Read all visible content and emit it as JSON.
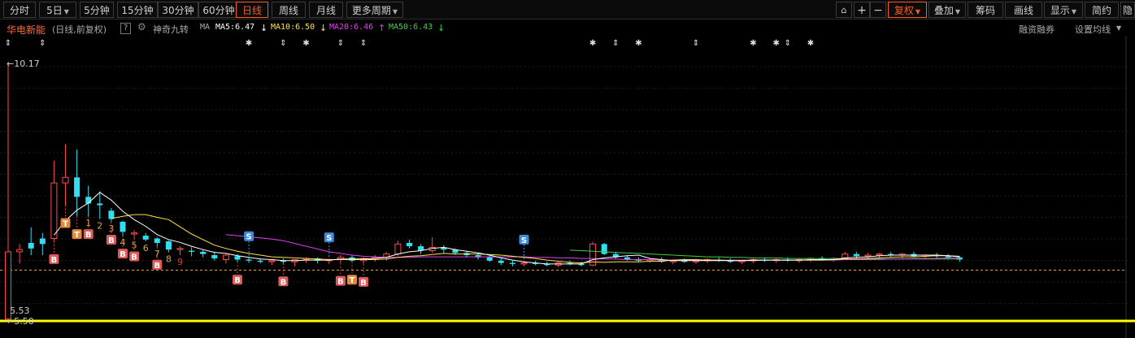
{
  "toolbar": {
    "left": [
      "分时",
      "5日",
      "5分钟",
      "15分钟",
      "30分钟",
      "60分钟",
      "日线",
      "周线",
      "月线",
      "更多周期"
    ],
    "active_period": "日线",
    "right_icons": [
      "lock-icon",
      "plus-icon",
      "minus-icon"
    ],
    "right": [
      "复权",
      "叠加",
      "筹码",
      "画线",
      "显示",
      "简约",
      "隐"
    ],
    "active_right": "复权"
  },
  "info": {
    "stock_name": "华电新能",
    "period_desc": "(日线,前复权)",
    "help": "?",
    "indicator": "神奇九转",
    "ma_label": "MA",
    "ma5": "MA5:6.47",
    "ma10": "MA10:6.50",
    "ma20": "MA20:6.46",
    "ma50": "MA50:6.43",
    "ma5_arrow": "↓",
    "ma10_arrow": "↓",
    "ma20_arrow": "↑",
    "ma50_arrow": "↓",
    "margin_link": "融资融券",
    "ma_settings": "设置均线"
  },
  "colors": {
    "bg": "#000000",
    "up": "#ff4a4a",
    "down": "#30e0f0",
    "ma5": "#ffffff",
    "ma10": "#ffe04a",
    "ma20": "#e040f0",
    "ma50": "#40d040",
    "current_price": "#ffff00",
    "accent": "#ff5a1e"
  },
  "chart_data": {
    "type": "candlestick",
    "price_high_label": "10.17",
    "price_low_label": "5.53",
    "bottom_label": "5.50",
    "ylim": [
      5.5,
      10.3
    ],
    "current_price": 6.43,
    "dates": 84,
    "candles": [
      [
        5.55,
        10.17,
        5.53,
        6.76
      ],
      [
        6.76,
        6.9,
        6.55,
        6.8
      ],
      [
        6.92,
        7.2,
        6.7,
        6.82
      ],
      [
        7.0,
        7.1,
        6.7,
        6.9
      ],
      [
        7.0,
        8.4,
        6.95,
        8.0
      ],
      [
        8.0,
        8.7,
        7.6,
        8.1
      ],
      [
        8.1,
        8.6,
        7.4,
        7.75
      ],
      [
        7.75,
        7.95,
        7.4,
        7.63
      ],
      [
        7.63,
        7.85,
        7.35,
        7.6
      ],
      [
        7.5,
        7.55,
        7.3,
        7.35
      ],
      [
        7.3,
        7.32,
        7.05,
        7.12
      ],
      [
        7.08,
        7.15,
        7.0,
        7.1
      ],
      [
        7.05,
        7.1,
        6.95,
        6.98
      ],
      [
        7.0,
        7.02,
        6.85,
        6.92
      ],
      [
        6.95,
        6.96,
        6.75,
        6.8
      ],
      [
        6.8,
        6.86,
        6.7,
        6.82
      ],
      [
        6.78,
        6.84,
        6.68,
        6.76
      ],
      [
        6.76,
        6.8,
        6.66,
        6.72
      ],
      [
        6.7,
        6.76,
        6.6,
        6.64
      ],
      [
        6.62,
        6.72,
        6.55,
        6.7
      ],
      [
        6.68,
        6.72,
        6.58,
        6.62
      ],
      [
        6.62,
        6.66,
        6.56,
        6.6
      ],
      [
        6.6,
        6.64,
        6.55,
        6.58
      ],
      [
        6.58,
        6.62,
        6.52,
        6.6
      ],
      [
        6.6,
        6.64,
        6.55,
        6.58
      ],
      [
        6.58,
        6.62,
        6.5,
        6.62
      ],
      [
        6.62,
        6.66,
        6.56,
        6.64
      ],
      [
        6.64,
        6.66,
        6.55,
        6.6
      ],
      [
        6.6,
        6.64,
        6.54,
        6.62
      ],
      [
        6.62,
        6.7,
        6.56,
        6.66
      ],
      [
        6.66,
        6.7,
        6.58,
        6.6
      ],
      [
        6.6,
        6.66,
        6.54,
        6.64
      ],
      [
        6.64,
        6.7,
        6.58,
        6.66
      ],
      [
        6.66,
        6.76,
        6.6,
        6.72
      ],
      [
        6.72,
        6.96,
        6.68,
        6.9
      ],
      [
        6.92,
        6.98,
        6.82,
        6.86
      ],
      [
        6.86,
        6.9,
        6.72,
        6.78
      ],
      [
        6.78,
        7.02,
        6.74,
        6.84
      ],
      [
        6.84,
        6.88,
        6.74,
        6.8
      ],
      [
        6.8,
        6.82,
        6.7,
        6.74
      ],
      [
        6.74,
        6.78,
        6.66,
        6.7
      ],
      [
        6.7,
        6.74,
        6.62,
        6.66
      ],
      [
        6.66,
        6.7,
        6.58,
        6.6
      ],
      [
        6.6,
        6.64,
        6.52,
        6.56
      ],
      [
        6.56,
        6.6,
        6.5,
        6.54
      ],
      [
        6.54,
        6.6,
        6.5,
        6.56
      ],
      [
        6.56,
        6.6,
        6.52,
        6.54
      ],
      [
        6.54,
        6.58,
        6.5,
        6.52
      ],
      [
        6.52,
        6.58,
        6.48,
        6.56
      ],
      [
        6.56,
        6.6,
        6.52,
        6.54
      ],
      [
        6.54,
        6.58,
        6.5,
        6.52
      ],
      [
        6.52,
        6.94,
        6.5,
        6.9
      ],
      [
        6.9,
        6.92,
        6.7,
        6.72
      ],
      [
        6.72,
        6.76,
        6.62,
        6.66
      ],
      [
        6.66,
        6.7,
        6.6,
        6.62
      ],
      [
        6.62,
        6.66,
        6.58,
        6.6
      ],
      [
        6.6,
        6.64,
        6.56,
        6.62
      ],
      [
        6.62,
        6.66,
        6.56,
        6.58
      ],
      [
        6.58,
        6.62,
        6.54,
        6.6
      ],
      [
        6.6,
        6.64,
        6.56,
        6.58
      ],
      [
        6.58,
        6.62,
        6.54,
        6.6
      ],
      [
        6.6,
        6.64,
        6.56,
        6.62
      ],
      [
        6.62,
        6.66,
        6.58,
        6.6
      ],
      [
        6.6,
        6.64,
        6.56,
        6.58
      ],
      [
        6.58,
        6.62,
        6.54,
        6.6
      ],
      [
        6.6,
        6.64,
        6.56,
        6.62
      ],
      [
        6.62,
        6.66,
        6.58,
        6.6
      ],
      [
        6.6,
        6.64,
        6.56,
        6.62
      ],
      [
        6.62,
        6.66,
        6.58,
        6.6
      ],
      [
        6.6,
        6.64,
        6.56,
        6.62
      ],
      [
        6.62,
        6.66,
        6.58,
        6.64
      ],
      [
        6.64,
        6.68,
        6.6,
        6.62
      ],
      [
        6.62,
        6.66,
        6.58,
        6.64
      ],
      [
        6.64,
        6.76,
        6.62,
        6.72
      ],
      [
        6.72,
        6.76,
        6.64,
        6.68
      ],
      [
        6.68,
        6.74,
        6.64,
        6.7
      ],
      [
        6.7,
        6.74,
        6.64,
        6.72
      ],
      [
        6.72,
        6.76,
        6.66,
        6.7
      ],
      [
        6.7,
        6.74,
        6.64,
        6.72
      ],
      [
        6.72,
        6.76,
        6.66,
        6.68
      ],
      [
        6.68,
        6.72,
        6.62,
        6.7
      ],
      [
        6.7,
        6.74,
        6.64,
        6.68
      ],
      [
        6.68,
        6.72,
        6.62,
        6.66
      ],
      [
        6.66,
        6.68,
        6.58,
        6.62
      ]
    ],
    "ma5": [
      null,
      null,
      null,
      null,
      7.06,
      7.32,
      7.51,
      7.64,
      7.83,
      7.69,
      7.49,
      7.34,
      7.22,
      7.07,
      6.98,
      6.93,
      6.86,
      6.8,
      6.75,
      6.73,
      6.69,
      6.66,
      6.63,
      6.62,
      6.6,
      6.6,
      6.61,
      6.61,
      6.61,
      6.63,
      6.63,
      6.63,
      6.64,
      6.66,
      6.72,
      6.76,
      6.78,
      6.82,
      6.84,
      6.8,
      6.77,
      6.74,
      6.7,
      6.65,
      6.61,
      6.58,
      6.56,
      6.54,
      6.54,
      6.54,
      6.54,
      6.62,
      6.65,
      6.67,
      6.69,
      6.7,
      6.64,
      6.62,
      6.6,
      6.6,
      6.6,
      6.6,
      6.6,
      6.6,
      6.6,
      6.61,
      6.61,
      6.61,
      6.61,
      6.61,
      6.62,
      6.62,
      6.62,
      6.65,
      6.66,
      6.67,
      6.69,
      6.7,
      6.7,
      6.7,
      6.7,
      6.7,
      6.69,
      6.67
    ],
    "ma10": [
      null,
      null,
      null,
      null,
      null,
      null,
      null,
      null,
      null,
      7.36,
      7.4,
      7.43,
      7.43,
      7.38,
      7.34,
      7.21,
      7.08,
      6.98,
      6.88,
      6.82,
      6.77,
      6.73,
      6.7,
      6.67,
      6.66,
      6.65,
      6.64,
      6.63,
      6.62,
      6.62,
      6.62,
      6.62,
      6.62,
      6.63,
      6.66,
      6.68,
      6.69,
      6.71,
      6.73,
      6.72,
      6.72,
      6.72,
      6.71,
      6.7,
      6.68,
      6.66,
      6.64,
      6.61,
      6.59,
      6.57,
      6.56,
      6.58,
      6.57,
      6.58,
      6.58,
      6.58,
      6.59,
      6.59,
      6.61,
      6.62,
      6.62,
      6.61,
      6.61,
      6.6,
      6.6,
      6.6,
      6.61,
      6.61,
      6.61,
      6.61,
      6.61,
      6.61,
      6.62,
      6.63,
      6.63,
      6.64,
      6.65,
      6.66,
      6.67,
      6.67,
      6.68,
      6.69,
      6.69,
      6.68
    ],
    "ma20": [
      null,
      null,
      null,
      null,
      null,
      null,
      null,
      null,
      null,
      null,
      null,
      null,
      null,
      null,
      null,
      null,
      null,
      null,
      null,
      7.07,
      7.05,
      7.03,
      7.01,
      6.99,
      6.96,
      6.91,
      6.86,
      6.81,
      6.76,
      6.73,
      6.7,
      6.68,
      6.67,
      6.66,
      6.66,
      6.66,
      6.67,
      6.67,
      6.67,
      6.67,
      6.67,
      6.67,
      6.67,
      6.67,
      6.67,
      6.67,
      6.66,
      6.66,
      6.65,
      6.65,
      6.64,
      6.64,
      6.63,
      6.63,
      6.62,
      6.62,
      6.62,
      6.61,
      6.61,
      6.61,
      6.61,
      6.61,
      6.61,
      6.61,
      6.61,
      6.61,
      6.61,
      6.61,
      6.61,
      6.61,
      6.61,
      6.61,
      6.61,
      6.62,
      6.62,
      6.62,
      6.62,
      6.63,
      6.63,
      6.64,
      6.64,
      6.64,
      6.65,
      6.65
    ],
    "ma50": [
      null,
      null,
      null,
      null,
      null,
      null,
      null,
      null,
      null,
      null,
      null,
      null,
      null,
      null,
      null,
      null,
      null,
      null,
      null,
      null,
      null,
      null,
      null,
      null,
      null,
      null,
      null,
      null,
      null,
      null,
      null,
      null,
      null,
      null,
      null,
      null,
      null,
      null,
      null,
      null,
      null,
      null,
      null,
      null,
      null,
      null,
      null,
      null,
      null,
      6.79,
      6.78,
      6.77,
      6.76,
      6.75,
      6.74,
      6.73,
      6.72,
      6.71,
      6.7,
      6.69,
      6.68,
      6.67,
      6.67,
      6.66,
      6.66,
      6.65,
      6.65,
      6.65,
      6.64,
      6.64,
      6.64,
      6.64,
      6.64,
      6.63,
      6.63,
      6.63,
      6.63,
      6.63,
      6.63,
      6.63,
      6.63,
      6.63,
      6.63,
      6.63
    ]
  },
  "markers": {
    "top_symbols": [
      {
        "i": 0,
        "s": "⇕"
      },
      {
        "i": 3,
        "s": "⇕"
      },
      {
        "i": 21,
        "s": "✱"
      },
      {
        "i": 24,
        "s": "⇕"
      },
      {
        "i": 26,
        "s": "✱"
      },
      {
        "i": 29,
        "s": "⇕"
      },
      {
        "i": 31,
        "s": "⇕"
      },
      {
        "i": 51,
        "s": "✱"
      },
      {
        "i": 53,
        "s": "⇕"
      },
      {
        "i": 55,
        "s": "✱"
      },
      {
        "i": 60,
        "s": "⇕"
      },
      {
        "i": 65,
        "s": "✱"
      },
      {
        "i": 67,
        "s": "✱"
      },
      {
        "i": 68,
        "s": "⇕"
      },
      {
        "i": 70,
        "s": "✱"
      }
    ],
    "signals": [
      {
        "i": 4,
        "label": "B",
        "below": true
      },
      {
        "i": 5,
        "label": "T",
        "below": true
      },
      {
        "i": 6,
        "label": "T",
        "below": true
      },
      {
        "i": 7,
        "label": "B",
        "below": true
      },
      {
        "i": 9,
        "label": "B",
        "below": true
      },
      {
        "i": 10,
        "label": "B",
        "below": true
      },
      {
        "i": 11,
        "label": "B",
        "below": true
      },
      {
        "i": 13,
        "label": "B",
        "below": true
      },
      {
        "i": 20,
        "label": "B",
        "below": true
      },
      {
        "i": 24,
        "label": "B",
        "below": true
      },
      {
        "i": 29,
        "label": "B",
        "below": true
      },
      {
        "i": 30,
        "label": "T",
        "below": true
      },
      {
        "i": 31,
        "label": "B",
        "below": true
      },
      {
        "i": 21,
        "label": "S",
        "below": false
      },
      {
        "i": 28,
        "label": "S",
        "below": false
      },
      {
        "i": 45,
        "label": "S",
        "below": false
      }
    ],
    "nine_turn": [
      {
        "i": 7,
        "n": "1"
      },
      {
        "i": 8,
        "n": "2"
      },
      {
        "i": 9,
        "n": "3"
      },
      {
        "i": 10,
        "n": "4"
      },
      {
        "i": 11,
        "n": "5"
      },
      {
        "i": 12,
        "n": "6"
      },
      {
        "i": 13,
        "n": "7"
      },
      {
        "i": 14,
        "n": "8"
      },
      {
        "i": 15,
        "n": "9"
      }
    ]
  }
}
